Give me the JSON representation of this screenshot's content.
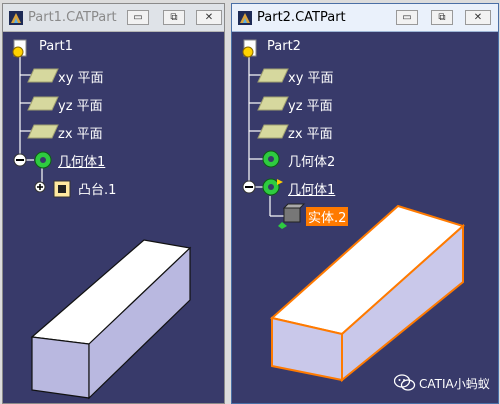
{
  "windows": [
    {
      "title": "Part1.CATPart",
      "controls": {
        "minimize": "▭",
        "restore": "⧉",
        "close": "✕"
      },
      "tree": {
        "root": "Part1",
        "planes": [
          "xy 平面",
          "yz 平面",
          "zx 平面"
        ],
        "body": "几何体1",
        "feature": "凸台.1"
      }
    },
    {
      "title": "Part2.CATPart",
      "controls": {
        "minimize": "▭",
        "restore": "⧉",
        "close": "✕"
      },
      "tree": {
        "root": "Part2",
        "planes": [
          "xy 平面",
          "yz 平面",
          "zx 平面"
        ],
        "body2": "几何体2",
        "body1": "几何体1",
        "solid": "实体.2"
      }
    }
  ],
  "watermark": "CATIA小蚂蚁",
  "colors": {
    "background": "#383a6a",
    "selection": "#ff7a00",
    "tree_line": "#ffffff",
    "body_icon": "#2ecc40"
  }
}
